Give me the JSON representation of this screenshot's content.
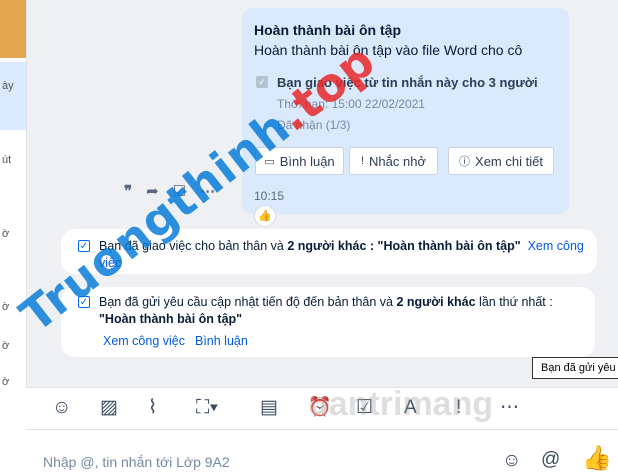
{
  "sidebar": {
    "fragments": [
      "ày",
      "út",
      "ờ",
      "ờ",
      "ờ",
      "ờ"
    ]
  },
  "message": {
    "title": "Hoàn thành bài ôn tập",
    "description": "Hoàn thành bài ôn tập vào file Word cho cô",
    "assign_text": "Bạn giao việc từ tin nhắn này cho 3 người",
    "deadline": "Thời hạn: 15:00 22/02/2021",
    "received": "Đã nhận (1/3)",
    "buttons": {
      "comment": "Bình luận",
      "remind": "Nhắc nhở",
      "details": "Xem chi tiết"
    },
    "time": "10:15"
  },
  "notices": [
    {
      "prefix": "Bạn đã giao việc cho bản thân và ",
      "bold": "2 người khác",
      "suffix": " : \"Hoàn thành bài ôn tập\"",
      "link": "Xem công việc"
    },
    {
      "prefix": "Bạn đã gửi yêu cầu cập nhật tiến độ đến bản thân và ",
      "bold": "2 người khác",
      "suffix": " lần thứ nhất :",
      "task": "\"Hoàn thành bài ôn tập\"",
      "link1": "Xem công việc",
      "link2": "Bình luận"
    }
  ],
  "tooltip": "Bạn đã gửi yêu",
  "composer": {
    "placeholder": "Nhập @, tin nhắn tới Lớp 9A2"
  },
  "watermark": {
    "main": "Truongthinh",
    "dot": ".",
    "tld": "top",
    "secondary": "uantrimang"
  },
  "colors": {
    "card_bg": "#dbe9fd",
    "link": "#005ae0",
    "accent": "#0068ff"
  }
}
